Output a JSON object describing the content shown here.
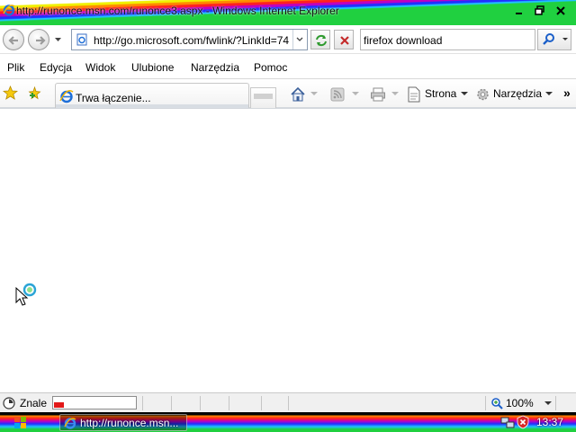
{
  "window": {
    "title": "http://runonce.msn.com/runonce3.aspx - Windows Internet Explorer",
    "minimize_icon": "minimize-icon",
    "maximize_icon": "restore-icon",
    "close_icon": "close-icon"
  },
  "address_bar": {
    "url": "http://go.microsoft.com/fwlink/?LinkId=74",
    "back_icon": "back-arrow-icon",
    "forward_icon": "forward-arrow-icon",
    "refresh_icon": "refresh-icon",
    "stop_icon": "stop-icon"
  },
  "search": {
    "value": "firefox download",
    "icon": "search-icon"
  },
  "menu": {
    "items": [
      "Plik",
      "Edycja",
      "Widok",
      "Ulubione",
      "Narzędzia",
      "Pomoc"
    ]
  },
  "tabs": [
    {
      "title": "Trwa łączenie...",
      "icon": "ie-page-icon"
    }
  ],
  "command_bar": {
    "home_icon": "home-icon",
    "feeds_icon": "rss-feed-icon",
    "print_icon": "printer-icon",
    "page_label": "Strona",
    "tools_label": "Narzędzia",
    "more_label": "»"
  },
  "status_bar": {
    "text": "Znale",
    "progress_percent": 12,
    "zoom": "100%"
  },
  "taskbar": {
    "task_label": "http://runonce.msn...",
    "clock": "13:37"
  },
  "colors": {
    "progress_fill": "#e21818",
    "title_stripe_green": "#20d040",
    "address_border": "#8a9bb0"
  }
}
